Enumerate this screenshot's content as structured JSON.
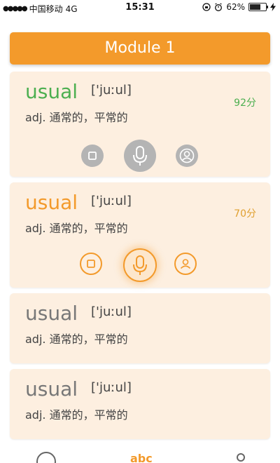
{
  "status_bar": {
    "signal": "●●●●●",
    "carrier": "中国移动",
    "network": "4G",
    "time": "15:31",
    "battery_pct": "62%"
  },
  "module": {
    "title": "Module 1"
  },
  "cards": [
    {
      "word": "usual",
      "phonetic": "['juːul]",
      "definition": "adj.  通常的，平常的",
      "score": "92分"
    },
    {
      "word": "usual",
      "phonetic": "['juːul]",
      "definition": "adj.  通常的，平常的",
      "score": "70分"
    },
    {
      "word": "usual",
      "phonetic": "['juːul]",
      "definition": "adj.  通常的，平常的"
    },
    {
      "word": "usual",
      "phonetic": "['juːul]",
      "definition": "adj.  通常的，平常的"
    }
  ],
  "tabbar": {
    "tab2_label": "abc"
  },
  "colors": {
    "accent": "#f39a2b",
    "good": "#4caf50",
    "card_bg": "#fdefe0",
    "inactive": "#b4b4b4"
  }
}
